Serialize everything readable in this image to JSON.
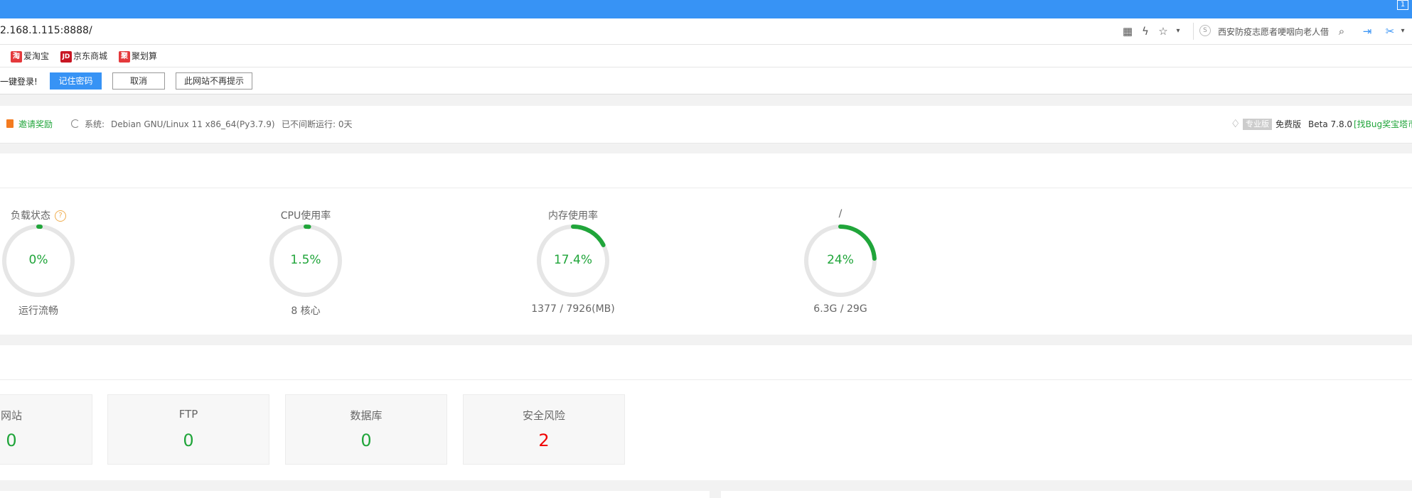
{
  "browser": {
    "window_badge": "1",
    "url": "2.168.1.115:8888/",
    "search_placeholder": "西安防疫志愿者哽咽向老人借",
    "search_engine_glyph": "S",
    "bookmarks": [
      {
        "icon": "淘",
        "label": "爱淘宝",
        "color": "#e4393c"
      },
      {
        "icon": "JD",
        "label": "京东商城",
        "color": "#c81623"
      },
      {
        "icon": "聚",
        "label": "聚划算",
        "color": "#e4393c"
      }
    ]
  },
  "password_bar": {
    "prompt": "一键登录!",
    "save_label": "记住密码",
    "cancel_label": "取消",
    "never_label": "此网站不再提示"
  },
  "info_bar": {
    "invite_label": "邀请奖励",
    "system_label": "系统:",
    "system_value": "Debian GNU/Linux 11 x86_64(Py3.7.9)",
    "uptime": "已不间断运行: 0天",
    "pro_badge": "专业版",
    "free_label": "免费版",
    "beta_version": "Beta  7.8.0",
    "bug_link": "[找Bug奖宝塔币"
  },
  "status": {
    "gauges": [
      {
        "title": "负载状态",
        "value": "0%",
        "percent": 0,
        "subtitle": "运行流畅",
        "has_help": true
      },
      {
        "title": "CPU使用率",
        "value": "1.5%",
        "percent": 1.5,
        "subtitle": "8 核心",
        "has_help": false
      },
      {
        "title": "内存使用率",
        "value": "17.4%",
        "percent": 17.4,
        "subtitle": "1377 / 7926(MB)",
        "has_help": false
      },
      {
        "title": "/",
        "value": "24%",
        "percent": 24,
        "subtitle": "6.3G / 29G",
        "has_help": false
      }
    ],
    "track_color": "#e6e6e6",
    "arc_color": "#20a53a"
  },
  "overview": {
    "cards": [
      {
        "label": "网站",
        "value": "0",
        "color": "#20a53a"
      },
      {
        "label": "FTP",
        "value": "0",
        "color": "#20a53a"
      },
      {
        "label": "数据库",
        "value": "0",
        "color": "#20a53a"
      },
      {
        "label": "安全风险",
        "value": "2",
        "color": "#f00000"
      }
    ]
  },
  "colors": {
    "browser_accent": "#3793f5",
    "brand_green": "#20a53a"
  }
}
